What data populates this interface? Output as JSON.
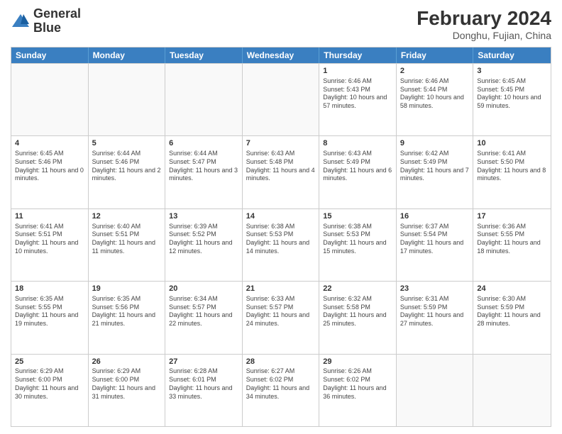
{
  "header": {
    "logo_line1": "General",
    "logo_line2": "Blue",
    "month_year": "February 2024",
    "location": "Donghu, Fujian, China"
  },
  "weekdays": [
    "Sunday",
    "Monday",
    "Tuesday",
    "Wednesday",
    "Thursday",
    "Friday",
    "Saturday"
  ],
  "rows": [
    [
      {
        "day": "",
        "info": ""
      },
      {
        "day": "",
        "info": ""
      },
      {
        "day": "",
        "info": ""
      },
      {
        "day": "",
        "info": ""
      },
      {
        "day": "1",
        "info": "Sunrise: 6:46 AM\nSunset: 5:43 PM\nDaylight: 10 hours and 57 minutes."
      },
      {
        "day": "2",
        "info": "Sunrise: 6:46 AM\nSunset: 5:44 PM\nDaylight: 10 hours and 58 minutes."
      },
      {
        "day": "3",
        "info": "Sunrise: 6:45 AM\nSunset: 5:45 PM\nDaylight: 10 hours and 59 minutes."
      }
    ],
    [
      {
        "day": "4",
        "info": "Sunrise: 6:45 AM\nSunset: 5:46 PM\nDaylight: 11 hours and 0 minutes."
      },
      {
        "day": "5",
        "info": "Sunrise: 6:44 AM\nSunset: 5:46 PM\nDaylight: 11 hours and 2 minutes."
      },
      {
        "day": "6",
        "info": "Sunrise: 6:44 AM\nSunset: 5:47 PM\nDaylight: 11 hours and 3 minutes."
      },
      {
        "day": "7",
        "info": "Sunrise: 6:43 AM\nSunset: 5:48 PM\nDaylight: 11 hours and 4 minutes."
      },
      {
        "day": "8",
        "info": "Sunrise: 6:43 AM\nSunset: 5:49 PM\nDaylight: 11 hours and 6 minutes."
      },
      {
        "day": "9",
        "info": "Sunrise: 6:42 AM\nSunset: 5:49 PM\nDaylight: 11 hours and 7 minutes."
      },
      {
        "day": "10",
        "info": "Sunrise: 6:41 AM\nSunset: 5:50 PM\nDaylight: 11 hours and 8 minutes."
      }
    ],
    [
      {
        "day": "11",
        "info": "Sunrise: 6:41 AM\nSunset: 5:51 PM\nDaylight: 11 hours and 10 minutes."
      },
      {
        "day": "12",
        "info": "Sunrise: 6:40 AM\nSunset: 5:51 PM\nDaylight: 11 hours and 11 minutes."
      },
      {
        "day": "13",
        "info": "Sunrise: 6:39 AM\nSunset: 5:52 PM\nDaylight: 11 hours and 12 minutes."
      },
      {
        "day": "14",
        "info": "Sunrise: 6:38 AM\nSunset: 5:53 PM\nDaylight: 11 hours and 14 minutes."
      },
      {
        "day": "15",
        "info": "Sunrise: 6:38 AM\nSunset: 5:53 PM\nDaylight: 11 hours and 15 minutes."
      },
      {
        "day": "16",
        "info": "Sunrise: 6:37 AM\nSunset: 5:54 PM\nDaylight: 11 hours and 17 minutes."
      },
      {
        "day": "17",
        "info": "Sunrise: 6:36 AM\nSunset: 5:55 PM\nDaylight: 11 hours and 18 minutes."
      }
    ],
    [
      {
        "day": "18",
        "info": "Sunrise: 6:35 AM\nSunset: 5:55 PM\nDaylight: 11 hours and 19 minutes."
      },
      {
        "day": "19",
        "info": "Sunrise: 6:35 AM\nSunset: 5:56 PM\nDaylight: 11 hours and 21 minutes."
      },
      {
        "day": "20",
        "info": "Sunrise: 6:34 AM\nSunset: 5:57 PM\nDaylight: 11 hours and 22 minutes."
      },
      {
        "day": "21",
        "info": "Sunrise: 6:33 AM\nSunset: 5:57 PM\nDaylight: 11 hours and 24 minutes."
      },
      {
        "day": "22",
        "info": "Sunrise: 6:32 AM\nSunset: 5:58 PM\nDaylight: 11 hours and 25 minutes."
      },
      {
        "day": "23",
        "info": "Sunrise: 6:31 AM\nSunset: 5:59 PM\nDaylight: 11 hours and 27 minutes."
      },
      {
        "day": "24",
        "info": "Sunrise: 6:30 AM\nSunset: 5:59 PM\nDaylight: 11 hours and 28 minutes."
      }
    ],
    [
      {
        "day": "25",
        "info": "Sunrise: 6:29 AM\nSunset: 6:00 PM\nDaylight: 11 hours and 30 minutes."
      },
      {
        "day": "26",
        "info": "Sunrise: 6:29 AM\nSunset: 6:00 PM\nDaylight: 11 hours and 31 minutes."
      },
      {
        "day": "27",
        "info": "Sunrise: 6:28 AM\nSunset: 6:01 PM\nDaylight: 11 hours and 33 minutes."
      },
      {
        "day": "28",
        "info": "Sunrise: 6:27 AM\nSunset: 6:02 PM\nDaylight: 11 hours and 34 minutes."
      },
      {
        "day": "29",
        "info": "Sunrise: 6:26 AM\nSunset: 6:02 PM\nDaylight: 11 hours and 36 minutes."
      },
      {
        "day": "",
        "info": ""
      },
      {
        "day": "",
        "info": ""
      }
    ]
  ]
}
